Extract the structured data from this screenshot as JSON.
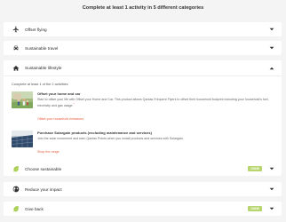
{
  "page": {
    "title": "Complete at least 1 activity in 5 different categories"
  },
  "colors": {
    "badge_bg": "#b7d66f",
    "link": "#e85a3a",
    "icon_dark": "#333333",
    "icon_green": "#a9cf54"
  },
  "categories": [
    {
      "label": "Offset flying",
      "icon": "airplane-icon"
    },
    {
      "label": "Sustainable travel",
      "icon": "car-icon"
    },
    {
      "label": "Sustainable lifestyle",
      "icon": "home-icon",
      "expanded": true
    },
    {
      "label": "Choose sustainable",
      "icon": "leaf-icon",
      "badge": "DONE"
    },
    {
      "label": "Reduce your impact",
      "icon": "globe-icon"
    },
    {
      "label": "Give back",
      "icon": "leaf-icon",
      "badge": "DONE"
    }
  ],
  "lifestyle_section": {
    "intro": "Complete at least 1 of the 2 activities",
    "items": [
      {
        "title": "Offset your home and car",
        "description": "Start to offset your life with Offset your Home and Car. This product allows Qantas Frequent Flyers to offset their household footprint including your household's fuel, electricity and gas usage.",
        "marker": "*",
        "link": "Offset your household emissions",
        "image": "family-in-yard-photo"
      },
      {
        "title": "Purchase Solargain products (excluding maintenance and services)",
        "description": "Join the solar movement and earn Qantas Points when you install products and services with Solargain.",
        "marker": "",
        "link": "Shop the range",
        "image": "solar-panels-photo"
      }
    ]
  }
}
